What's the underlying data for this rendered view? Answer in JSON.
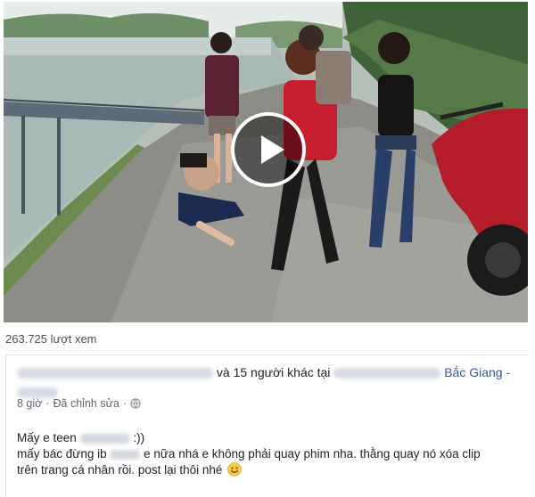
{
  "views_text": "263.725 lượt xem",
  "post": {
    "with_others": "và 15 người khác",
    "at_word": "tại",
    "location_suffix": "Bắc Giang -",
    "time": "8 giờ",
    "separator": "·",
    "edited": "Đã chỉnh sửa",
    "line1_start": "Mấy e teen",
    "line1_end": ":))",
    "line2_start": "mấy bác đừng ib",
    "line2_end": "e nữa nhá e không phải quay phim nha. thằng quay nó xóa clip",
    "line3": "trên trang cá nhân rồi. post lại thôi nhé"
  },
  "icons": {
    "play": "play-icon",
    "globe": "globe-icon",
    "emoji": "smiley-emoji-icon"
  },
  "colors": {
    "link": "#365899",
    "meta": "#616770",
    "text": "#1d2129"
  }
}
